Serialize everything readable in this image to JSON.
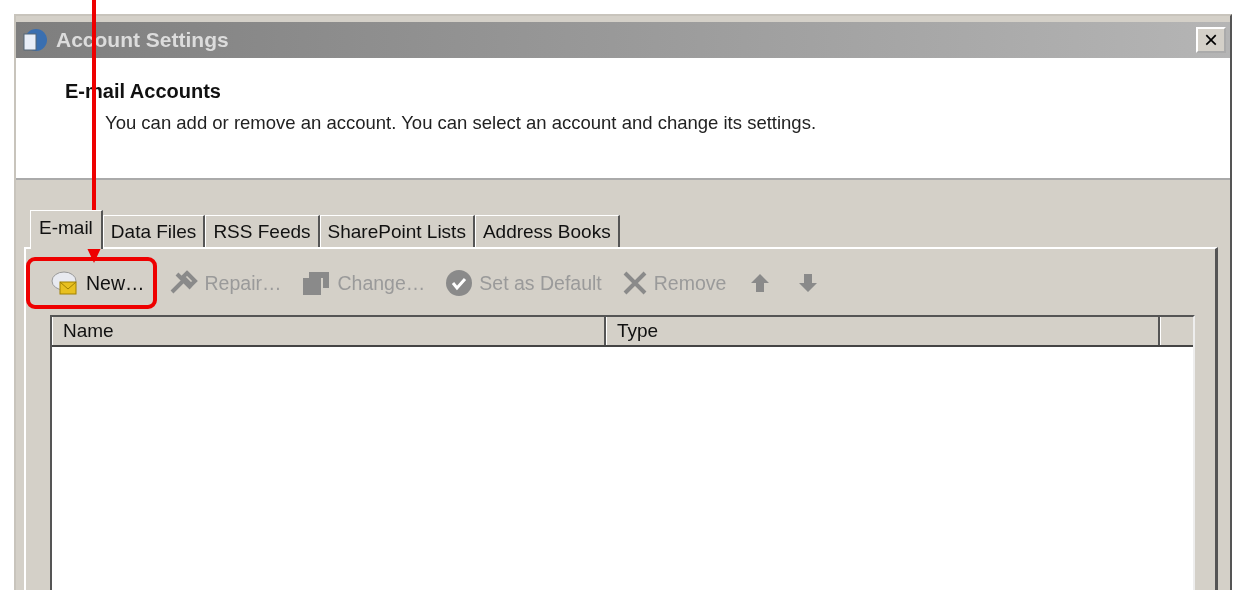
{
  "window": {
    "title": "Account Settings",
    "close_label": "×"
  },
  "header": {
    "title": "E-mail Accounts",
    "description": "You can add or remove an account. You can select an account and change its settings."
  },
  "tabs": [
    {
      "label": "E-mail",
      "selected": true
    },
    {
      "label": "Data Files",
      "selected": false
    },
    {
      "label": "RSS Feeds",
      "selected": false
    },
    {
      "label": "SharePoint Lists",
      "selected": false
    },
    {
      "label": "Address Books",
      "selected": false
    }
  ],
  "toolbar": {
    "buttons": [
      {
        "label": "New…",
        "disabled": false,
        "highlighted": true
      },
      {
        "label": "Repair…",
        "disabled": true,
        "highlighted": false
      },
      {
        "label": "Change…",
        "disabled": true,
        "highlighted": false
      },
      {
        "label": "Set as Default",
        "disabled": true,
        "highlighted": false
      },
      {
        "label": "Remove",
        "disabled": true,
        "highlighted": false
      }
    ],
    "move_buttons": [
      {
        "disabled": true
      },
      {
        "disabled": true
      }
    ]
  },
  "table": {
    "columns": [
      "Name",
      "Type"
    ]
  }
}
